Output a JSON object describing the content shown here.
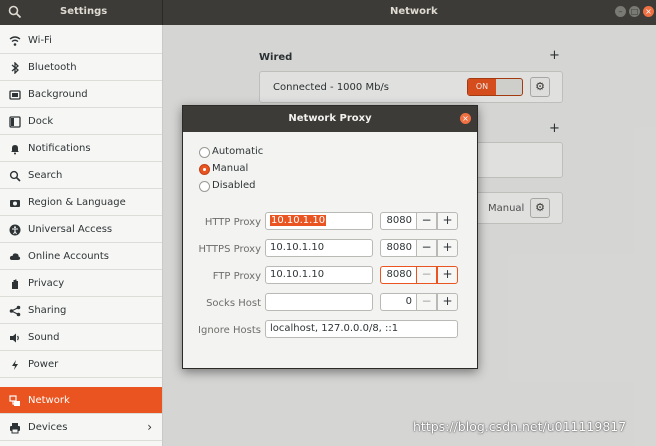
{
  "titlebar": {
    "left_title": "Settings",
    "center_title": "Network"
  },
  "sidebar": {
    "items": [
      {
        "label": "Wi-Fi",
        "icon": "wifi-icon"
      },
      {
        "label": "Bluetooth",
        "icon": "bluetooth-icon"
      },
      {
        "label": "Background",
        "icon": "background-icon"
      },
      {
        "label": "Dock",
        "icon": "dock-icon"
      },
      {
        "label": "Notifications",
        "icon": "bell-icon"
      },
      {
        "label": "Search",
        "icon": "search-icon"
      },
      {
        "label": "Region & Language",
        "icon": "camera-icon"
      },
      {
        "label": "Universal Access",
        "icon": "accessibility-icon"
      },
      {
        "label": "Online Accounts",
        "icon": "cloud-icon"
      },
      {
        "label": "Privacy",
        "icon": "hand-icon"
      },
      {
        "label": "Sharing",
        "icon": "share-icon"
      },
      {
        "label": "Sound",
        "icon": "speaker-icon"
      },
      {
        "label": "Power",
        "icon": "battery-icon"
      },
      {
        "label": "Network",
        "icon": "network-icon"
      },
      {
        "label": "Devices",
        "icon": "printer-icon"
      }
    ],
    "active": "Network"
  },
  "main": {
    "wired": {
      "title": "Wired",
      "add": "+",
      "connection": "Connected - 1000 Mb/s",
      "toggle": "ON"
    },
    "second_add": "+",
    "proxy_mode": "Manual"
  },
  "dialog": {
    "title": "Network Proxy",
    "close": "×",
    "modes": [
      {
        "label": "Automatic",
        "checked": false
      },
      {
        "label": "Manual",
        "checked": true
      },
      {
        "label": "Disabled",
        "checked": false
      }
    ],
    "fields": [
      {
        "label": "HTTP Proxy",
        "host": "10.10.1.10",
        "port": "8080"
      },
      {
        "label": "HTTPS Proxy",
        "host": "10.10.1.10",
        "port": "8080"
      },
      {
        "label": "FTP Proxy",
        "host": "10.10.1.10",
        "port": "8080"
      },
      {
        "label": "Socks Host",
        "host": "",
        "port": "0"
      }
    ],
    "ignore": {
      "label": "Ignore Hosts",
      "value": "localhost, 127.0.0.0/8, ::1"
    },
    "stepper": {
      "minus": "−",
      "plus": "+"
    }
  },
  "watermark": "https://blog.csdn.net/u011119817",
  "colors": {
    "accent": "#e95420",
    "titlebar": "#3c3b37",
    "sidebar": "#f6f6f5"
  }
}
